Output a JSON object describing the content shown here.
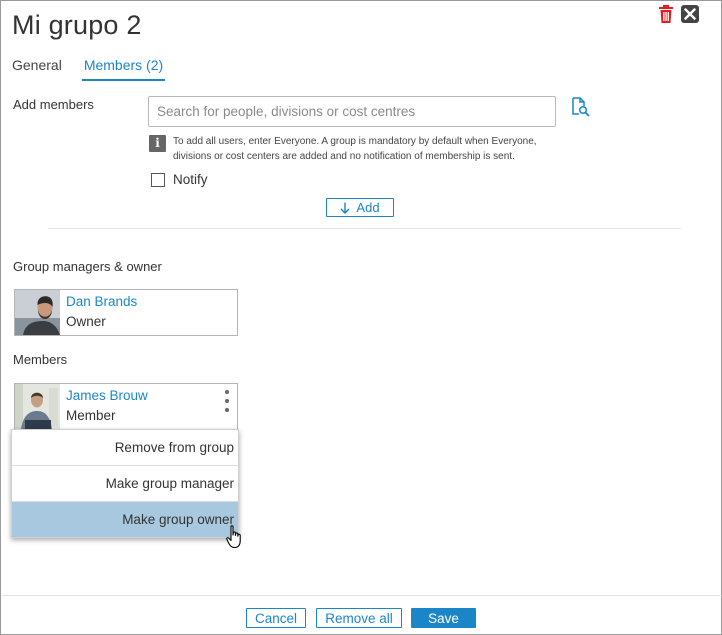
{
  "dialog": {
    "title": "Mi grupo 2"
  },
  "tabs": [
    {
      "label": "General",
      "active": false
    },
    {
      "label": "Members (2)",
      "active": true
    }
  ],
  "add_members": {
    "label": "Add members",
    "search_placeholder": "Search for people, divisions or cost centres",
    "info_line1": "To add all users, enter Everyone. A group is mandatory by default when Everyone,",
    "info_line2": "divisions or cost centers are added and no notification of membership is sent.",
    "notify_label": "Notify",
    "notify_checked": false,
    "add_button": "Add"
  },
  "managers": {
    "heading": "Group managers & owner",
    "items": [
      {
        "name": "Dan Brands",
        "role": "Owner"
      }
    ]
  },
  "members": {
    "heading": "Members",
    "items": [
      {
        "name": "James Brouw",
        "role": "Member"
      }
    ]
  },
  "context_menu": {
    "items": [
      {
        "label": "Remove from group"
      },
      {
        "label": "Make group manager"
      },
      {
        "label": "Make group owner",
        "highlighted": true
      }
    ]
  },
  "footer": {
    "cancel": "Cancel",
    "remove_all": "Remove all",
    "save": "Save"
  },
  "colors": {
    "accent": "#1a86c8",
    "delete_icon": "#e02020",
    "menu_highlight": "#a8c8e0"
  },
  "icons": [
    "trash-icon",
    "close-icon",
    "search-document-icon",
    "info-icon",
    "arrow-down-icon",
    "more-vert-icon",
    "hand-cursor-icon"
  ]
}
